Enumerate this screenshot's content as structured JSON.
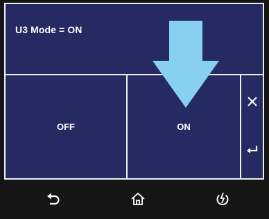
{
  "header": {
    "title": "U3 Mode = ON"
  },
  "options": {
    "off_label": "OFF",
    "on_label": "ON"
  },
  "side_buttons": {
    "close_icon": "close-icon",
    "enter_icon": "enter-icon"
  },
  "navbar": {
    "back_icon": "back-icon",
    "home_icon": "home-icon",
    "power_icon": "power-icon"
  },
  "colors": {
    "panel": "#262a63",
    "border": "#eef0f6",
    "arrow": "#88d0f0",
    "navbar": "#161616"
  }
}
